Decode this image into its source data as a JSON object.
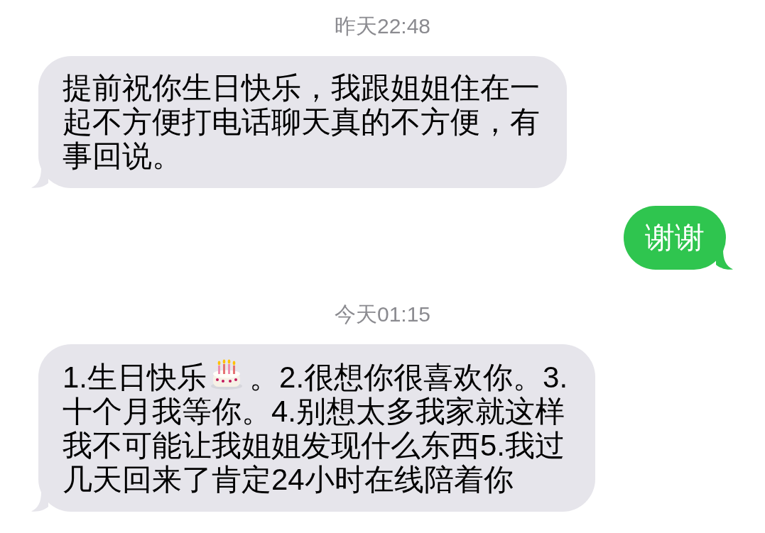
{
  "conversation": [
    {
      "kind": "timestamp",
      "text": "昨天22:48"
    },
    {
      "kind": "received",
      "segments": [
        {
          "kind": "text",
          "text": "提前祝你生日快乐，我跟姐姐住在一起不方便打电话聊天真的不方便，有事回说。"
        }
      ]
    },
    {
      "kind": "sent",
      "segments": [
        {
          "kind": "text",
          "text": "谢谢"
        }
      ]
    },
    {
      "kind": "timestamp",
      "text": "今天01:15"
    },
    {
      "kind": "received",
      "segments": [
        {
          "kind": "text",
          "text": "1.生日快乐"
        },
        {
          "kind": "cake"
        },
        {
          "kind": "text",
          "text": "。2.很想你很喜欢你。3."
        },
        {
          "kind": "text",
          "text": "十个月我等你。4.别想太多我家就这样我不可能让我姐姐发现什么东西5.我过几天回来了肯定24小时在线陪着你"
        }
      ]
    }
  ]
}
